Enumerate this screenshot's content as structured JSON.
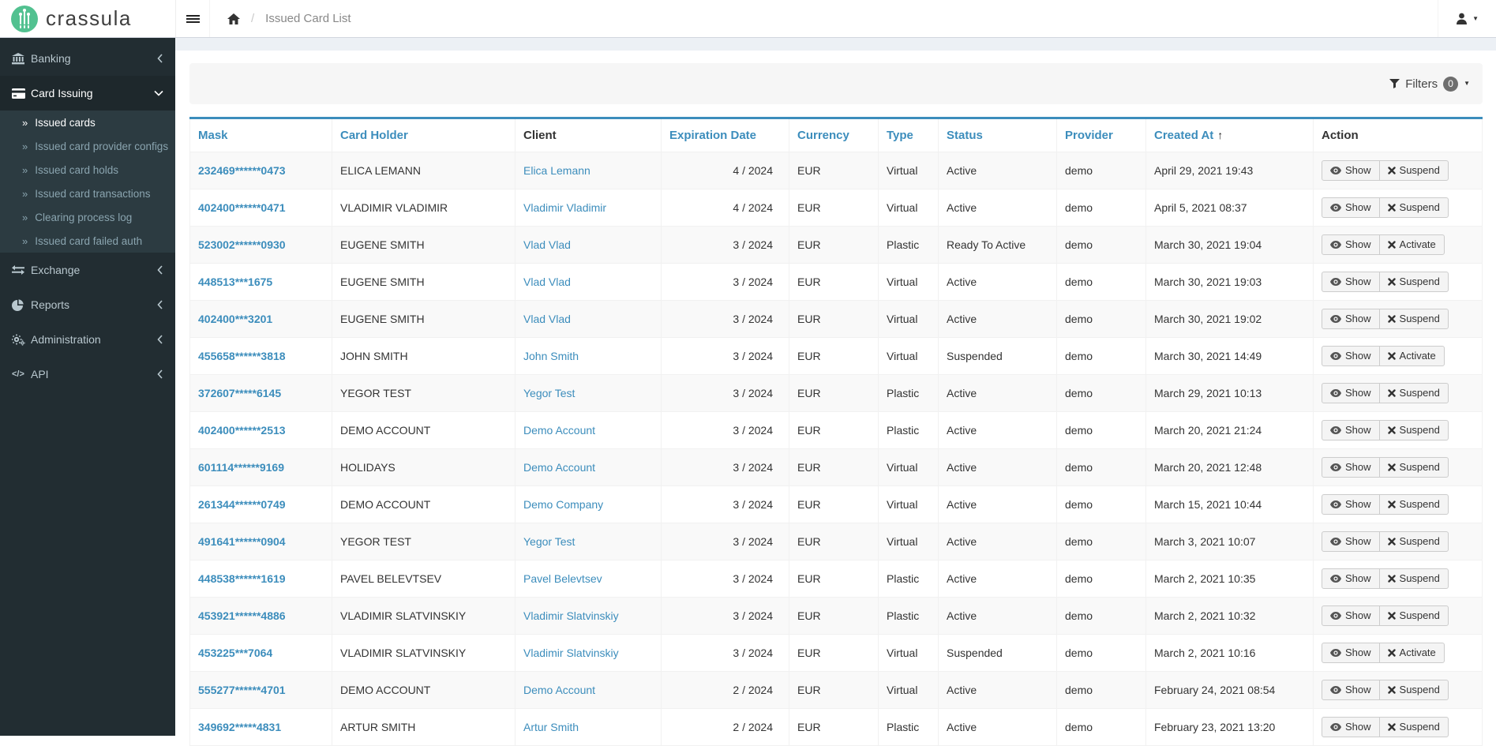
{
  "brand": {
    "name": "crassula"
  },
  "topbar": {
    "breadcrumb_page": "Issued Card List"
  },
  "icons": {
    "submenu_arrow": "»",
    "caret_down": "▼",
    "sort_asc": "↑",
    "api_glyph": "</>",
    "breadcrumb_separator": "/"
  },
  "colors": {
    "accent": "#3c8dbc",
    "sidebar_bg": "#222d32",
    "submenu_bg": "#2c3b41",
    "logo_green": "#52c190",
    "stripe": "#f9f9f9"
  },
  "sidebar": {
    "sections": [
      {
        "label": "Banking"
      },
      {
        "label": "Card Issuing",
        "children": [
          {
            "label": "Issued cards",
            "active": true
          },
          {
            "label": "Issued card provider configs"
          },
          {
            "label": "Issued card holds"
          },
          {
            "label": "Issued card transactions"
          },
          {
            "label": "Clearing process log"
          },
          {
            "label": "Issued card failed auth"
          }
        ]
      },
      {
        "label": "Exchange"
      },
      {
        "label": "Reports"
      },
      {
        "label": "Administration"
      },
      {
        "label": "API"
      }
    ]
  },
  "filters": {
    "label": "Filters",
    "count": "0"
  },
  "table": {
    "headers": {
      "mask": "Mask",
      "holder": "Card Holder",
      "client": "Client",
      "exp": "Expiration Date",
      "currency": "Currency",
      "type": "Type",
      "status": "Status",
      "provider": "Provider",
      "created": "Created At",
      "action": "Action"
    },
    "rows": [
      {
        "mask": "232469******0473",
        "holder": "ELICA LEMANN",
        "client": "Elica Lemann",
        "exp": "4 / 2024",
        "currency": "EUR",
        "type": "Virtual",
        "status": "Active",
        "provider": "demo",
        "created": "April 29, 2021 19:43",
        "action1": "Show",
        "action2": "Suspend"
      },
      {
        "mask": "402400******0471",
        "holder": "VLADIMIR VLADIMIR",
        "client": "Vladimir Vladimir",
        "exp": "4 / 2024",
        "currency": "EUR",
        "type": "Virtual",
        "status": "Active",
        "provider": "demo",
        "created": "April 5, 2021 08:37",
        "action1": "Show",
        "action2": "Suspend"
      },
      {
        "mask": "523002******0930",
        "holder": "EUGENE SMITH",
        "client": "Vlad Vlad",
        "exp": "3 / 2024",
        "currency": "EUR",
        "type": "Plastic",
        "status": "Ready To Active",
        "provider": "demo",
        "created": "March 30, 2021 19:04",
        "action1": "Show",
        "action2": "Activate"
      },
      {
        "mask": "448513***1675",
        "holder": "EUGENE SMITH",
        "client": "Vlad Vlad",
        "exp": "3 / 2024",
        "currency": "EUR",
        "type": "Virtual",
        "status": "Active",
        "provider": "demo",
        "created": "March 30, 2021 19:03",
        "action1": "Show",
        "action2": "Suspend"
      },
      {
        "mask": "402400***3201",
        "holder": "EUGENE SMITH",
        "client": "Vlad Vlad",
        "exp": "3 / 2024",
        "currency": "EUR",
        "type": "Virtual",
        "status": "Active",
        "provider": "demo",
        "created": "March 30, 2021 19:02",
        "action1": "Show",
        "action2": "Suspend"
      },
      {
        "mask": "455658******3818",
        "holder": "JOHN SMITH",
        "client": "John Smith",
        "exp": "3 / 2024",
        "currency": "EUR",
        "type": "Virtual",
        "status": "Suspended",
        "provider": "demo",
        "created": "March 30, 2021 14:49",
        "action1": "Show",
        "action2": "Activate"
      },
      {
        "mask": "372607*****6145",
        "holder": "YEGOR TEST",
        "client": "Yegor Test",
        "exp": "3 / 2024",
        "currency": "EUR",
        "type": "Plastic",
        "status": "Active",
        "provider": "demo",
        "created": "March 29, 2021 10:13",
        "action1": "Show",
        "action2": "Suspend"
      },
      {
        "mask": "402400******2513",
        "holder": "DEMO ACCOUNT",
        "client": "Demo Account",
        "exp": "3 / 2024",
        "currency": "EUR",
        "type": "Plastic",
        "status": "Active",
        "provider": "demo",
        "created": "March 20, 2021 21:24",
        "action1": "Show",
        "action2": "Suspend"
      },
      {
        "mask": "601114******9169",
        "holder": "HOLIDAYS",
        "client": "Demo Account",
        "exp": "3 / 2024",
        "currency": "EUR",
        "type": "Virtual",
        "status": "Active",
        "provider": "demo",
        "created": "March 20, 2021 12:48",
        "action1": "Show",
        "action2": "Suspend"
      },
      {
        "mask": "261344******0749",
        "holder": "DEMO ACCOUNT",
        "client": "Demo Company",
        "exp": "3 / 2024",
        "currency": "EUR",
        "type": "Virtual",
        "status": "Active",
        "provider": "demo",
        "created": "March 15, 2021 10:44",
        "action1": "Show",
        "action2": "Suspend"
      },
      {
        "mask": "491641******0904",
        "holder": "YEGOR TEST",
        "client": "Yegor Test",
        "exp": "3 / 2024",
        "currency": "EUR",
        "type": "Virtual",
        "status": "Active",
        "provider": "demo",
        "created": "March 3, 2021 10:07",
        "action1": "Show",
        "action2": "Suspend"
      },
      {
        "mask": "448538******1619",
        "holder": "PAVEL BELEVTSEV",
        "client": "Pavel Belevtsev",
        "exp": "3 / 2024",
        "currency": "EUR",
        "type": "Plastic",
        "status": "Active",
        "provider": "demo",
        "created": "March 2, 2021 10:35",
        "action1": "Show",
        "action2": "Suspend"
      },
      {
        "mask": "453921******4886",
        "holder": "VLADIMIR SLATVINSKIY",
        "client": "Vladimir Slatvinskiy",
        "exp": "3 / 2024",
        "currency": "EUR",
        "type": "Plastic",
        "status": "Active",
        "provider": "demo",
        "created": "March 2, 2021 10:32",
        "action1": "Show",
        "action2": "Suspend"
      },
      {
        "mask": "453225***7064",
        "holder": "VLADIMIR SLATVINSKIY",
        "client": "Vladimir Slatvinskiy",
        "exp": "3 / 2024",
        "currency": "EUR",
        "type": "Virtual",
        "status": "Suspended",
        "provider": "demo",
        "created": "March 2, 2021 10:16",
        "action1": "Show",
        "action2": "Activate"
      },
      {
        "mask": "555277******4701",
        "holder": "DEMO ACCOUNT",
        "client": "Demo Account",
        "exp": "2 / 2024",
        "currency": "EUR",
        "type": "Virtual",
        "status": "Active",
        "provider": "demo",
        "created": "February 24, 2021 08:54",
        "action1": "Show",
        "action2": "Suspend"
      },
      {
        "mask": "349692*****4831",
        "holder": "ARTUR SMITH",
        "client": "Artur Smith",
        "exp": "2 / 2024",
        "currency": "EUR",
        "type": "Plastic",
        "status": "Active",
        "provider": "demo",
        "created": "February 23, 2021 13:20",
        "action1": "Show",
        "action2": "Suspend"
      }
    ]
  }
}
